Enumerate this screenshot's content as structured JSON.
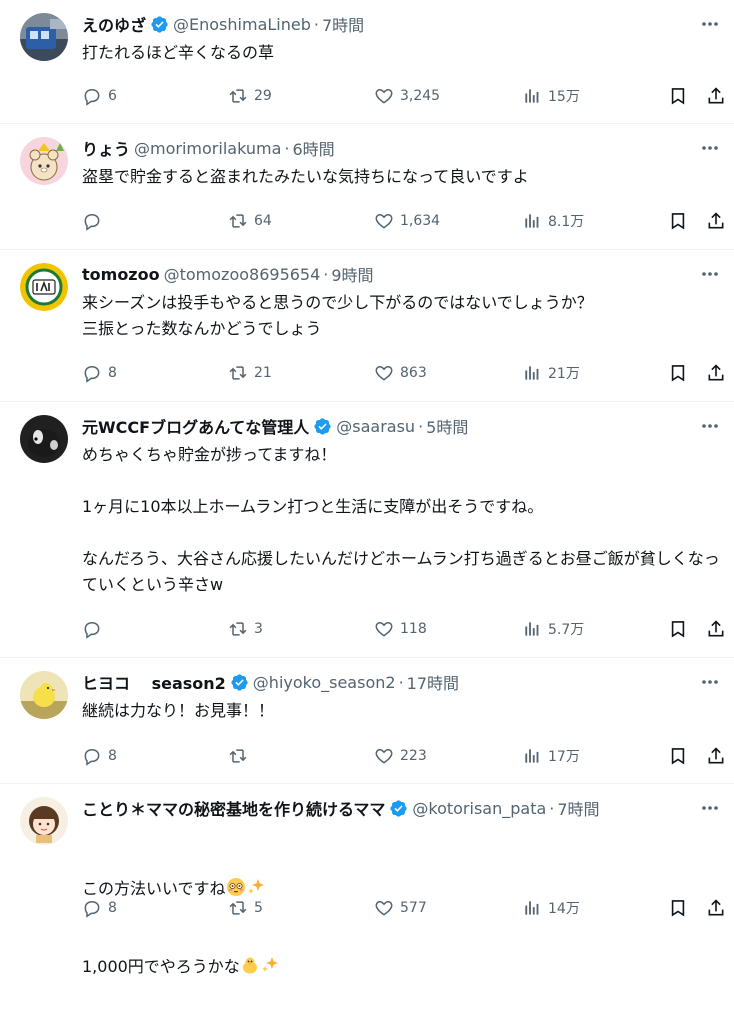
{
  "tweets": [
    {
      "name": "えのゆざ",
      "handle": "@EnoshimaLineb",
      "dot": "·",
      "time": "7時間",
      "text": "打たれるほど辛くなるの草",
      "replies": "6",
      "retweets": "29",
      "likes": "3,245",
      "views": "15万"
    },
    {
      "name": "りょう",
      "handle": "@morimorilakuma",
      "dot": "·",
      "time": "6時間",
      "text": "盗塁で貯金すると盗まれたみたいな気持ちになって良いですよ",
      "replies": "",
      "retweets": "64",
      "likes": "1,634",
      "views": "8.1万"
    },
    {
      "name": "tomozoo",
      "handle": "@tomozoo8695654",
      "dot": "·",
      "time": "9時間",
      "text": "来シーズンは投手もやると思うので少し下がるのではないでしょうか？\n三振とった数なんかどうでしょう",
      "replies": "8",
      "retweets": "21",
      "likes": "863",
      "views": "21万"
    },
    {
      "name": "元WCCFブログあんてな管理人",
      "handle": "@saarasu",
      "dot": "·",
      "time": "5時間",
      "text": "めちゃくちゃ貯金が捗ってますね！\n\n1ヶ月に10本以上ホームラン打つと生活に支障が出そうですね。\n\nなんだろう、大谷さん応援したいんだけどホームラン打ち過ぎるとお昼ご飯が貧しくなっていくという辛さw",
      "replies": "",
      "retweets": "3",
      "likes": "118",
      "views": "5.7万"
    },
    {
      "name": "ヒヨコ　 season2",
      "handle": "@hiyoko_season2",
      "dot": "·",
      "time": "17時間",
      "text": "継続は力なり！お見事！！",
      "replies": "8",
      "retweets": "",
      "likes": "223",
      "views": "17万"
    },
    {
      "name": "ことり＊ママの秘密基地を作り続けるママ",
      "handle": "@kotorisan_pata",
      "dot": "·",
      "time": "7時間",
      "text_line1": "この方法いいですね",
      "text_line2": "1,000円でやろうかな",
      "replies": "8",
      "retweets": "5",
      "likes": "577",
      "views": "14万"
    }
  ],
  "colors": {
    "text": "#0f1419",
    "secondary": "#536471",
    "verified": "#1d9bf0",
    "divider": "#eff3f4"
  }
}
